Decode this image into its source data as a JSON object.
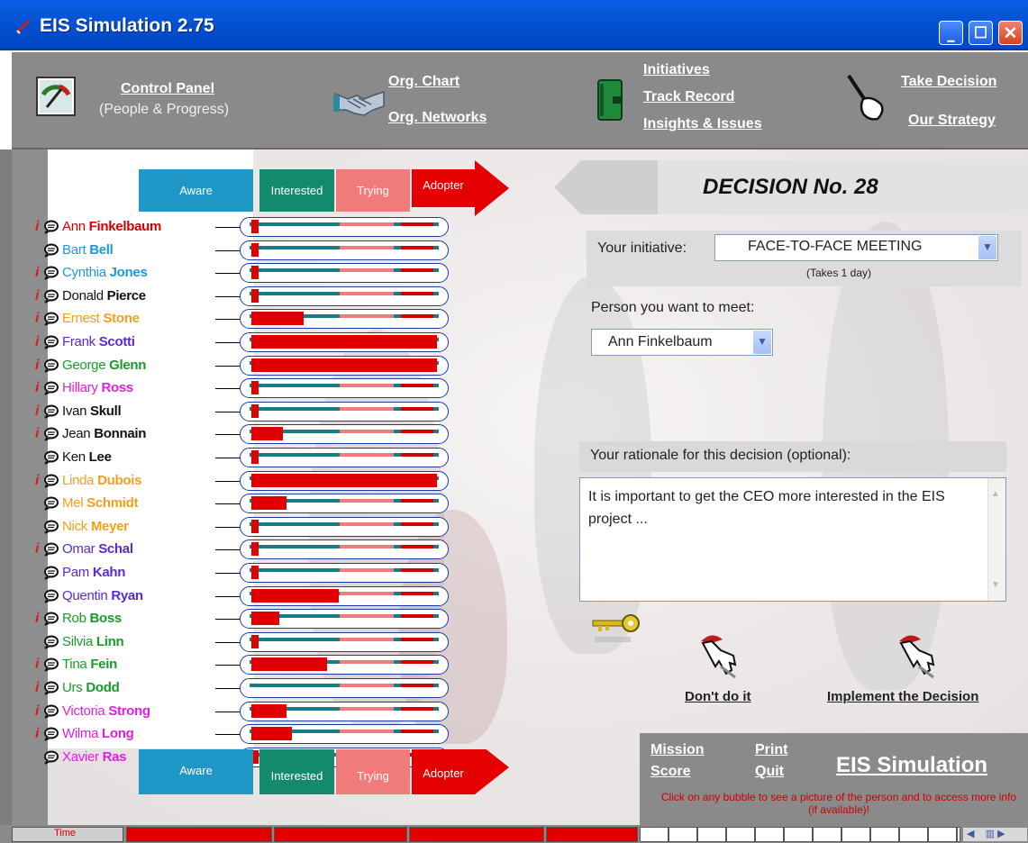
{
  "window": {
    "title": "EIS Simulation 2.75"
  },
  "toolbar": {
    "control_panel": "Control Panel",
    "control_panel_sub": "(People & Progress)",
    "org_chart": "Org. Chart",
    "org_networks": "Org. Networks",
    "initiatives": "Initiatives",
    "track_record": "Track Record",
    "insights": "Insights & Issues",
    "take_decision": "Take Decision",
    "our_strategy": "Our Strategy"
  },
  "stages": {
    "aware": "Aware",
    "interested": "Interested",
    "trying": "Trying",
    "adopter": "Adopter"
  },
  "colors": {
    "aware": "#1f98c8",
    "interested": "#138a6e",
    "trying": "#f07b7b",
    "adopter": "#e40000"
  },
  "people": [
    {
      "first": "Ann",
      "last": "Finkelbaum",
      "color": "#d40000",
      "info": true,
      "progress": 0.04
    },
    {
      "first": "Bart",
      "last": "Bell",
      "color": "#1f98d8",
      "info": false,
      "progress": 0.04
    },
    {
      "first": "Cynthia",
      "last": "Jones",
      "color": "#1f98d8",
      "info": true,
      "progress": 0.04
    },
    {
      "first": "Donald",
      "last": "Pierce",
      "color": "#111111",
      "info": true,
      "progress": 0.04
    },
    {
      "first": "Ernest",
      "last": "Stone",
      "color": "#f0a020",
      "info": true,
      "progress": 0.28
    },
    {
      "first": "Frank",
      "last": "Scotti",
      "color": "#5a2ad0",
      "info": true,
      "progress": 1.0
    },
    {
      "first": "George",
      "last": "Glenn",
      "color": "#1a9a2a",
      "info": true,
      "progress": 1.0
    },
    {
      "first": "Hillary",
      "last": "Ross",
      "color": "#e020e0",
      "info": true,
      "progress": 0.04
    },
    {
      "first": "Ivan",
      "last": "Skull",
      "color": "#111111",
      "info": true,
      "progress": 0.04
    },
    {
      "first": "Jean",
      "last": "Bonnain",
      "color": "#111111",
      "info": true,
      "progress": 0.17
    },
    {
      "first": "Ken",
      "last": "Lee",
      "color": "#111111",
      "info": false,
      "progress": 0.04
    },
    {
      "first": "Linda",
      "last": "Dubois",
      "color": "#f0a020",
      "info": true,
      "progress": 1.0
    },
    {
      "first": "Mel",
      "last": "Schmidt",
      "color": "#f0a020",
      "info": false,
      "progress": 0.19
    },
    {
      "first": "Nick",
      "last": "Meyer",
      "color": "#f0a020",
      "info": false,
      "progress": 0.04
    },
    {
      "first": "Omar",
      "last": "Schal",
      "color": "#5a2ad0",
      "info": true,
      "progress": 0.04
    },
    {
      "first": "Pam",
      "last": "Kahn",
      "color": "#5a2ad0",
      "info": false,
      "progress": 0.04
    },
    {
      "first": "Quentin",
      "last": "Ryan",
      "color": "#5a2ad0",
      "info": false,
      "progress": 0.47
    },
    {
      "first": "Rob",
      "last": "Boss",
      "color": "#1a9a2a",
      "info": true,
      "progress": 0.15
    },
    {
      "first": "Silvia",
      "last": "Linn",
      "color": "#1a9a2a",
      "info": false,
      "progress": 0.04
    },
    {
      "first": "Tina",
      "last": "Fein",
      "color": "#1a9a2a",
      "info": true,
      "progress": 0.41
    },
    {
      "first": "Urs",
      "last": "Dodd",
      "color": "#1a9a2a",
      "info": true,
      "progress": 0.0
    },
    {
      "first": "Victoria",
      "last": "Strong",
      "color": "#e020e0",
      "info": true,
      "progress": 0.19
    },
    {
      "first": "Wilma",
      "last": "Long",
      "color": "#e020e0",
      "info": true,
      "progress": 0.22
    },
    {
      "first": "Xavier",
      "last": "Ras",
      "color": "#e020e0",
      "info": false,
      "progress": 0.04
    }
  ],
  "decision": {
    "title": "DECISION No. 28",
    "initiative_label": "Your initiative:",
    "initiative_value": "FACE-TO-FACE MEETING",
    "takes": "(Takes 1 day)",
    "person_label": "Person you want to meet:",
    "person_value": "Ann Finkelbaum",
    "rationale_label": "Your rationale for this decision (optional):",
    "rationale_text": "It is important to get the CEO more interested in the EIS project ...",
    "dont": "Don't do it",
    "implement": "Implement the Decision"
  },
  "footer": {
    "mission": "Mission",
    "score": "Score",
    "print": "Print",
    "quit": "Quit",
    "brand": "EIS Simulation",
    "hint": "Click on any bubble to see a picture of the person and to access more info (if available)!",
    "time": "Time"
  }
}
